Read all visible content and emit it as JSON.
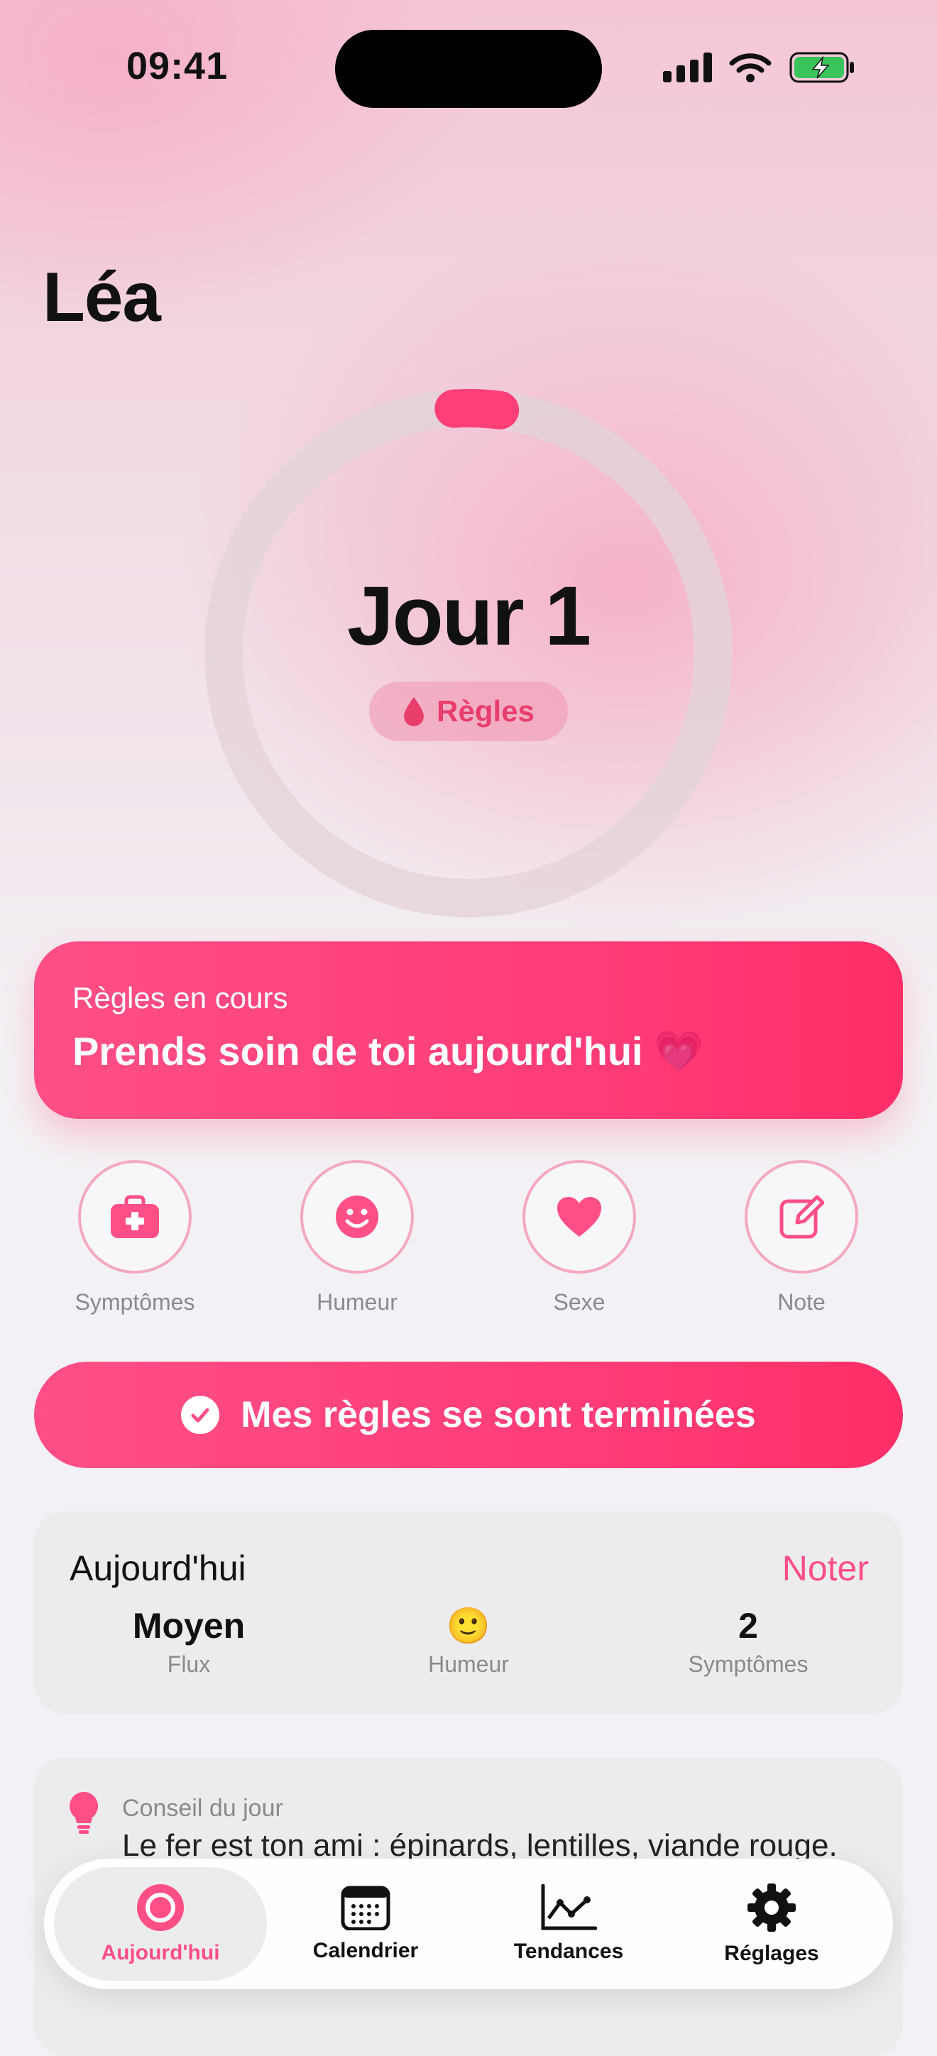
{
  "status_bar": {
    "time": "09:41"
  },
  "profile": {
    "name": "Léa"
  },
  "cycle": {
    "day_label": "Jour 1",
    "phase_label": "Règles",
    "progress_fraction": 0.03
  },
  "banner": {
    "subtitle": "Règles en cours",
    "title": "Prends soin de toi aujourd'hui 💗"
  },
  "quick_actions": [
    {
      "label": "Symptômes",
      "icon": "medical-kit-icon"
    },
    {
      "label": "Humeur",
      "icon": "smiley-icon"
    },
    {
      "label": "Sexe",
      "icon": "heart-icon"
    },
    {
      "label": "Note",
      "icon": "edit-note-icon"
    }
  ],
  "end_period_button": {
    "label": "Mes règles se sont terminées"
  },
  "today": {
    "title": "Aujourd'hui",
    "action": "Noter",
    "stats": [
      {
        "value": "Moyen",
        "label": "Flux"
      },
      {
        "value": "🙂",
        "label": "Humeur"
      },
      {
        "value": "2",
        "label": "Symptômes"
      }
    ]
  },
  "tip": {
    "label": "Conseil du jour",
    "text": "Le fer est ton ami : épinards, lentilles, viande rouge."
  },
  "tabbar": {
    "items": [
      {
        "label": "Aujourd'hui",
        "icon": "today-ring-icon",
        "active": true
      },
      {
        "label": "Calendrier",
        "icon": "calendar-icon",
        "active": false
      },
      {
        "label": "Tendances",
        "icon": "trends-chart-icon",
        "active": false
      },
      {
        "label": "Réglages",
        "icon": "gear-icon",
        "active": false
      }
    ]
  },
  "colors": {
    "accent": "#ff4f86",
    "ring_track": "#e3d3d9",
    "muted_text": "#8a8a8e"
  }
}
